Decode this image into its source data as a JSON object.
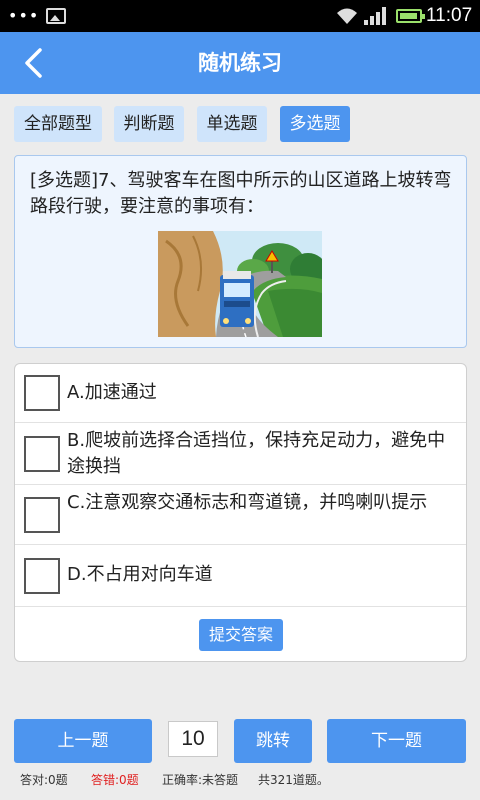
{
  "status_bar": {
    "time": "11:07",
    "accent": "#9be06b"
  },
  "header": {
    "title": "随机练习",
    "color": "#4d95ef"
  },
  "tabs": [
    {
      "label": "全部题型",
      "active": false
    },
    {
      "label": "判断题",
      "active": false
    },
    {
      "label": "单选题",
      "active": false
    },
    {
      "label": "多选题",
      "active": true
    }
  ],
  "question": {
    "text": "[多选题]7、驾驶客车在图中所示的山区道路上坡转弯路段行驶，要注意的事项有："
  },
  "options": [
    {
      "label": "A.加速通过",
      "checked": false
    },
    {
      "label": "B.爬坡前选择合适挡位，保持充足动力，避免中途换挡",
      "checked": false
    },
    {
      "label": "C.注意观察交通标志和弯道镜，并鸣喇叭提示",
      "checked": false
    },
    {
      "label": "D.不占用对向车道",
      "checked": false
    }
  ],
  "submit_label": "提交答案",
  "nav": {
    "prev_label": "上一题",
    "page_number": "10",
    "jump_label": "跳转",
    "next_label": "下一题"
  },
  "stats": {
    "correct": "答对:0题",
    "wrong": "答错:0题",
    "rate": "正确率:未答题",
    "total": "共321道题。"
  }
}
